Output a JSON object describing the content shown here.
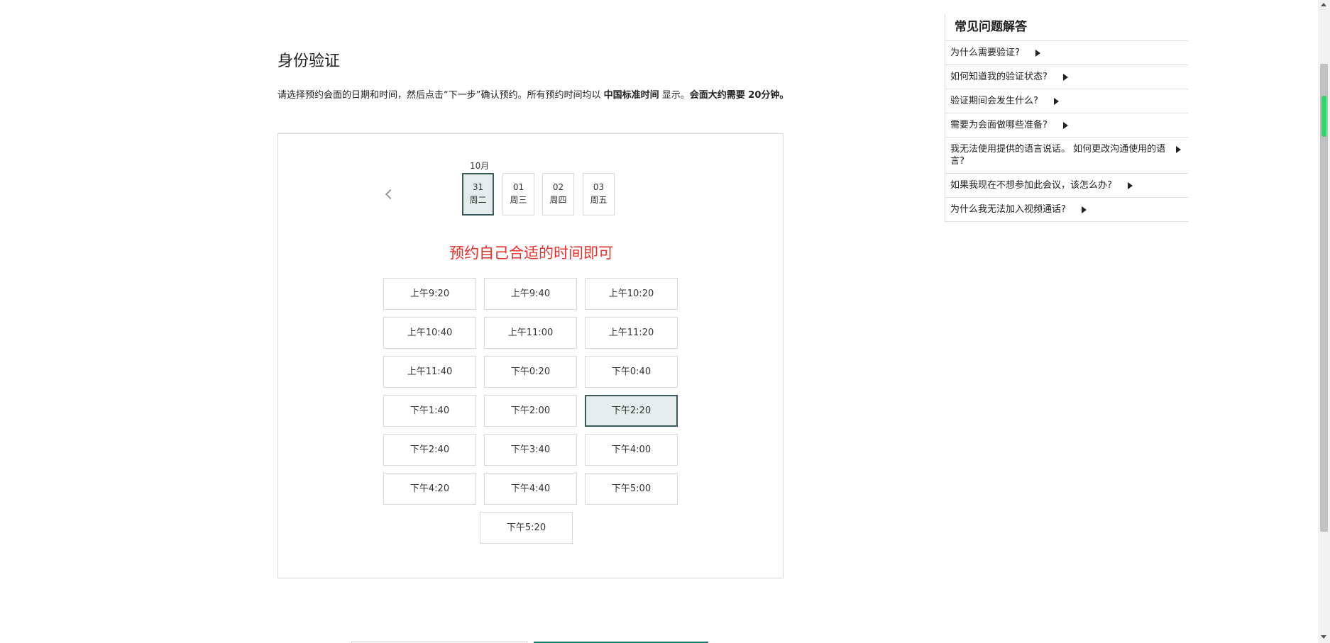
{
  "page": {
    "title": "身份验证",
    "intro_prefix": "请选择预约会面的日期和时间，然后点击“下一步”确认预约。所有预约时间均以 ",
    "intro_bold1": "中国标准时间",
    "intro_mid": " 显示。",
    "intro_bold2": "会面大约需要 20分钟。"
  },
  "calendar": {
    "month": "10月",
    "days": [
      {
        "date": "31",
        "weekday": "周二",
        "selected": true
      },
      {
        "date": "01",
        "weekday": "周三",
        "selected": false
      },
      {
        "date": "02",
        "weekday": "周四",
        "selected": false
      },
      {
        "date": "03",
        "weekday": "周五",
        "selected": false
      }
    ]
  },
  "notice": "预约自己合适的时间即可",
  "slots": [
    {
      "label": "上午9:20",
      "selected": false
    },
    {
      "label": "上午9:40",
      "selected": false
    },
    {
      "label": "上午10:20",
      "selected": false
    },
    {
      "label": "上午10:40",
      "selected": false
    },
    {
      "label": "上午11:00",
      "selected": false
    },
    {
      "label": "上午11:20",
      "selected": false
    },
    {
      "label": "上午11:40",
      "selected": false
    },
    {
      "label": "下午0:20",
      "selected": false
    },
    {
      "label": "下午0:40",
      "selected": false
    },
    {
      "label": "下午1:40",
      "selected": false
    },
    {
      "label": "下午2:00",
      "selected": false
    },
    {
      "label": "下午2:20",
      "selected": true
    },
    {
      "label": "下午2:40",
      "selected": false
    },
    {
      "label": "下午3:40",
      "selected": false
    },
    {
      "label": "下午4:00",
      "selected": false
    },
    {
      "label": "下午4:20",
      "selected": false
    },
    {
      "label": "下午4:40",
      "selected": false
    },
    {
      "label": "下午5:00",
      "selected": false
    },
    {
      "label": "下午5:20",
      "selected": false
    }
  ],
  "faq": {
    "title": "常见问题解答",
    "items": [
      "为什么需要验证?",
      "如何知道我的验证状态?",
      "验证期间会发生什么?",
      "需要为会面做哪些准备?",
      "我无法使用提供的语言说话。 如何更改沟通使用的语言?",
      "如果我现在不想参加此会议，该怎么办?",
      "为什么我无法加入视频通话?"
    ]
  },
  "colors": {
    "accent": "#3b5a5a",
    "notice": "#e8312a",
    "primary_button": "#1e7b74"
  }
}
